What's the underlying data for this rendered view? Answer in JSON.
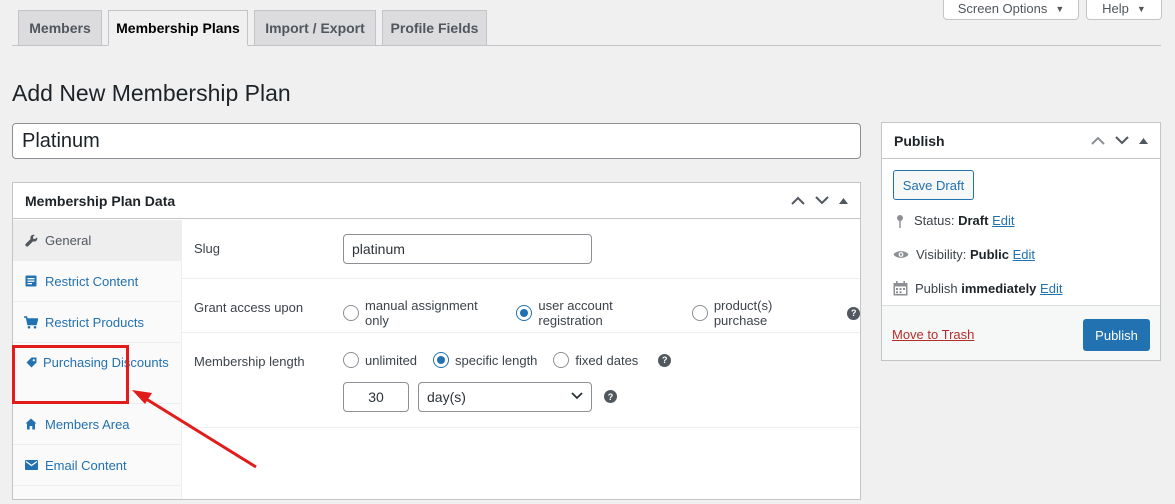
{
  "screen_meta": {
    "screen_options_label": "Screen Options",
    "help_label": "Help"
  },
  "tabs": [
    {
      "label": "Members",
      "active": false
    },
    {
      "label": "Membership Plans",
      "active": true
    },
    {
      "label": "Import / Export",
      "active": false
    },
    {
      "label": "Profile Fields",
      "active": false
    }
  ],
  "page_title": "Add New Membership Plan",
  "plan_name": "Platinum",
  "plan_data": {
    "title": "Membership Plan Data",
    "nav": [
      {
        "label": "General",
        "icon": "wrench-icon",
        "active": true
      },
      {
        "label": "Restrict Content",
        "icon": "document-icon",
        "active": false
      },
      {
        "label": "Restrict Products",
        "icon": "cart-icon",
        "active": false
      },
      {
        "label": "Purchasing Discounts",
        "icon": "tag-icon",
        "active": false
      },
      {
        "label": "Members Area",
        "icon": "home-icon",
        "active": false
      },
      {
        "label": "Email Content",
        "icon": "email-icon",
        "active": false
      }
    ],
    "slug_label": "Slug",
    "slug_value": "platinum",
    "grant_access_label": "Grant access upon",
    "grant_options": [
      "manual assignment only",
      "user account registration",
      "product(s) purchase"
    ],
    "grant_selected": "user account registration",
    "length_label": "Membership length",
    "length_options": [
      "unlimited",
      "specific length",
      "fixed dates"
    ],
    "length_selected": "specific length",
    "length_amount": "30",
    "length_period": "day(s)"
  },
  "publish": {
    "title": "Publish",
    "save_draft_label": "Save Draft",
    "status_label": "Status:",
    "status_value": "Draft",
    "visibility_label": "Visibility:",
    "visibility_value": "Public",
    "publish_label": "Publish",
    "publish_value": "immediately",
    "edit_label": "Edit",
    "trash_label": "Move to Trash",
    "publish_button": "Publish"
  },
  "colors": {
    "accent": "#2271b1",
    "annotation": "#e21b1b",
    "trash": "#b32d2e"
  }
}
